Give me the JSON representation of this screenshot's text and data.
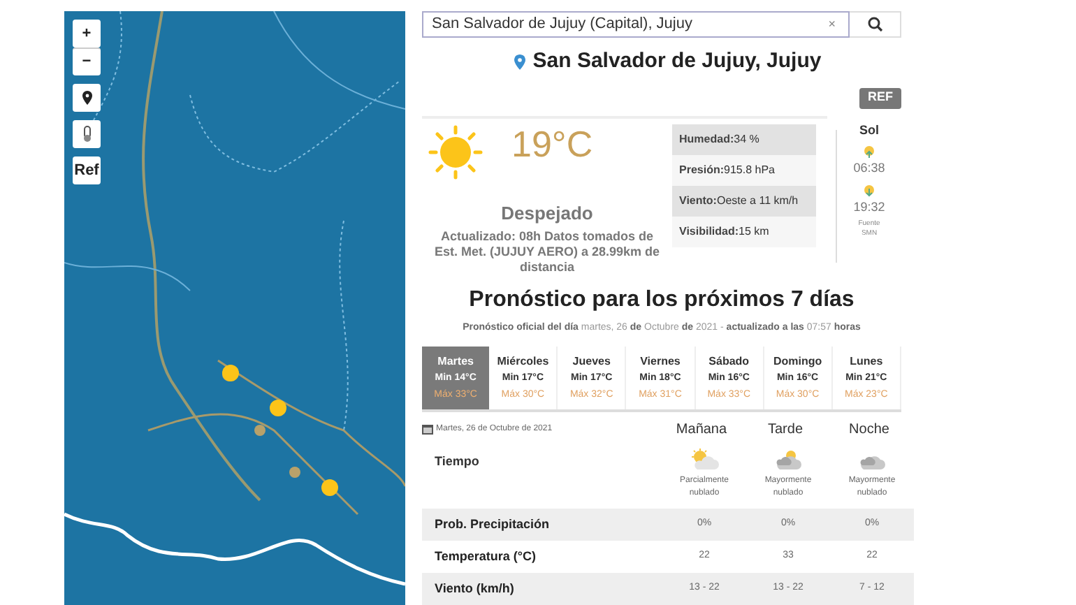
{
  "map": {
    "controls": [
      {
        "kind": "text",
        "label": "+"
      },
      {
        "kind": "text",
        "label": "−"
      },
      {
        "kind": "pin"
      },
      {
        "kind": "thermometer"
      },
      {
        "kind": "text",
        "label": "Ref"
      }
    ]
  },
  "search": {
    "value": "San Salvador de Jujuy (Capital), Jujuy",
    "clear": "×"
  },
  "location": "San Salvador de Jujuy, Jujuy",
  "ref_button": "REF",
  "current": {
    "temperature": "19°C",
    "condition": "Despejado",
    "updated": "Actualizado: 08h Datos tomados de Est. Met. (JUJUY AERO) a 28.99km de distancia",
    "details": [
      {
        "label": "Humedad:",
        "value": "34 %"
      },
      {
        "label": "Presión:",
        "value": "915.8 hPa"
      },
      {
        "label": "Viento:",
        "value": "Oeste a 11 km/h"
      },
      {
        "label": "Visibilidad:",
        "value": "15 km"
      }
    ]
  },
  "sun": {
    "title": "Sol",
    "sunrise": "06:38",
    "sunset": "19:32",
    "source": "Fuente SMN"
  },
  "forecast": {
    "title": "Pronóstico para los próximos 7 días",
    "subtitle": "**Pronóstico oficial del día** martes, 26 **de** Octubre **de** 2021 - **actualizado a las** 07:57 **horas**",
    "days": [
      {
        "name": "Martes",
        "min": "Min 14°C",
        "max": "Máx 33°C",
        "selected": true
      },
      {
        "name": "Miércoles",
        "min": "Min 17°C",
        "max": "Máx 30°C",
        "selected": false
      },
      {
        "name": "Jueves",
        "min": "Min 17°C",
        "max": "Máx 32°C",
        "selected": false
      },
      {
        "name": "Viernes",
        "min": "Min 18°C",
        "max": "Máx 31°C",
        "selected": false
      },
      {
        "name": "Sábado",
        "min": "Min 16°C",
        "max": "Máx 33°C",
        "selected": false
      },
      {
        "name": "Domingo",
        "min": "Min 16°C",
        "max": "Máx 30°C",
        "selected": false
      },
      {
        "name": "Lunes",
        "min": "Min 21°C",
        "max": "Máx 23°C",
        "selected": false
      }
    ]
  },
  "detail_table": {
    "date": "Martes, 26 de Octubre de 2021",
    "columns": [
      "Mañana",
      "Tarde",
      "Noche"
    ],
    "weather_label": "Tiempo",
    "weather": [
      {
        "kind": "sun_cloud",
        "text": "Parcialmente nublado"
      },
      {
        "kind": "grey_cloud_sun",
        "text": "Mayormente nublado"
      },
      {
        "kind": "grey_cloud",
        "text": "Mayormente nublado"
      }
    ],
    "rows": [
      {
        "label": "Prob. Precipitación",
        "values": [
          "0%",
          "0%",
          "0%"
        ]
      },
      {
        "label": "Temperatura (°C)",
        "values": [
          "22",
          "33",
          "22"
        ]
      },
      {
        "label": "Viento (km/h)",
        "values": [
          "13 - 22",
          "13 - 22",
          "7 - 12"
        ]
      }
    ]
  }
}
